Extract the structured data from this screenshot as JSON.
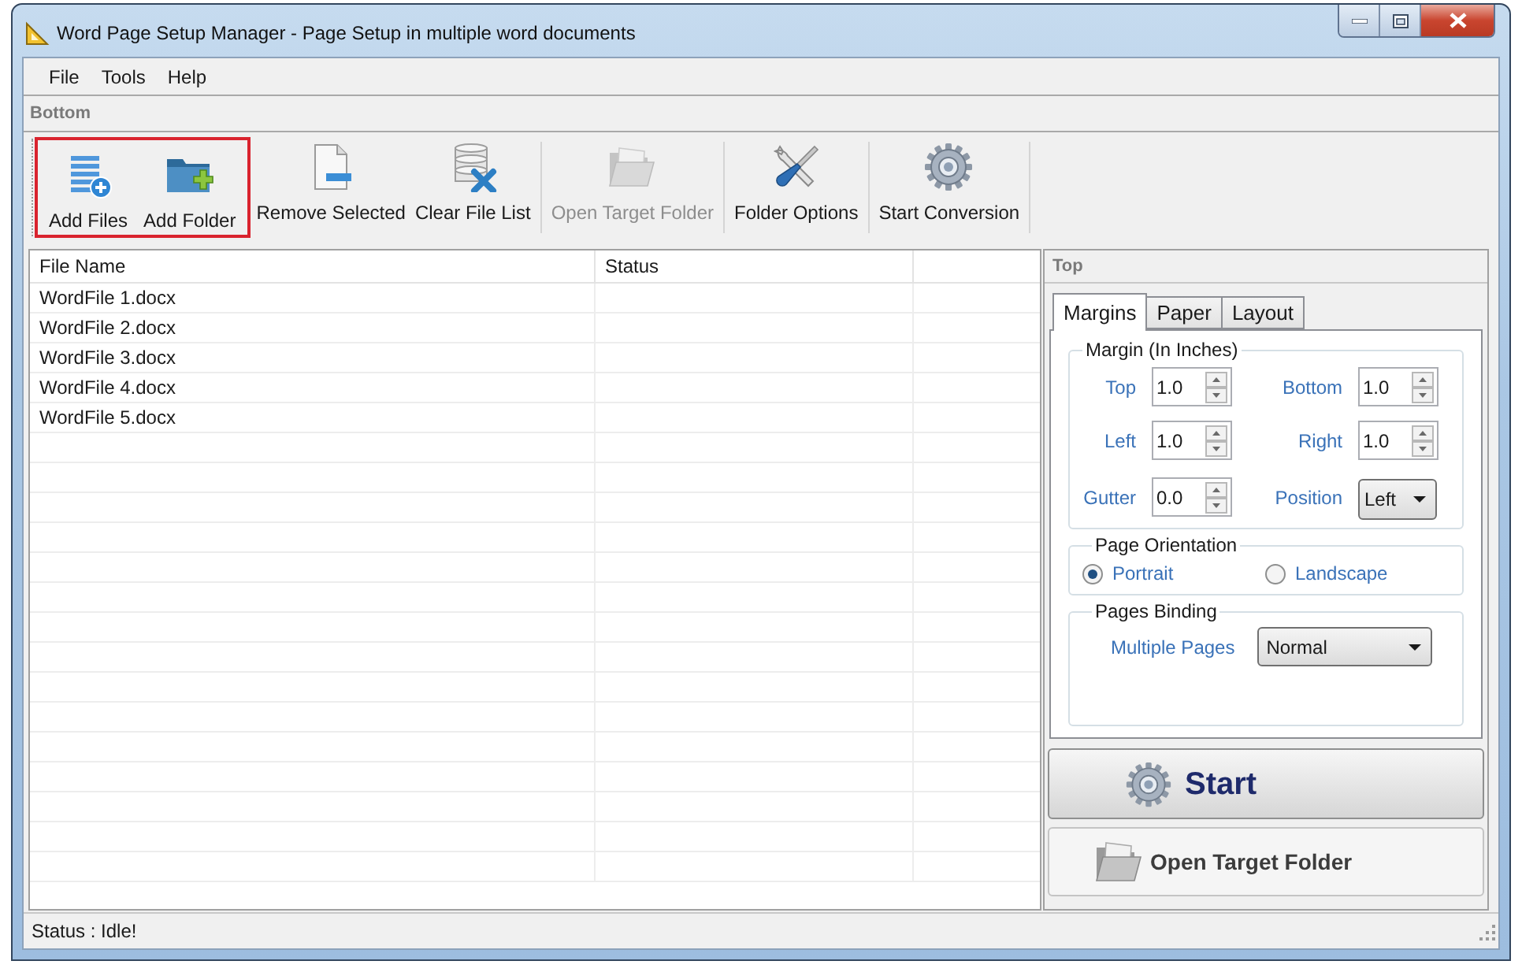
{
  "window": {
    "title": "Word Page Setup Manager - Page Setup in multiple word documents"
  },
  "menu": [
    {
      "label": "File"
    },
    {
      "label": "Tools"
    },
    {
      "label": "Help"
    }
  ],
  "toolbar": {
    "title": "Bottom",
    "groups": [
      [
        {
          "label": "Add Files",
          "disabled": false,
          "highlighted": true
        },
        {
          "label": "Add Folder",
          "disabled": false,
          "highlighted": true
        },
        {
          "label": "Remove Selected",
          "disabled": false,
          "highlighted": false
        },
        {
          "label": "Clear File List",
          "disabled": false,
          "highlighted": false
        }
      ],
      [
        {
          "label": "Open Target Folder",
          "disabled": true,
          "highlighted": false
        }
      ],
      [
        {
          "label": "Folder Options",
          "disabled": false,
          "highlighted": false
        }
      ],
      [
        {
          "label": "Start Conversion",
          "disabled": false,
          "highlighted": false
        }
      ]
    ]
  },
  "file_list": {
    "columns": [
      "File Name",
      "Status"
    ],
    "rows": [
      {
        "file_name": "WordFile 1.docx"
      },
      {
        "file_name": "WordFile 2.docx"
      },
      {
        "file_name": "WordFile 3.docx"
      },
      {
        "file_name": "WordFile 4.docx"
      },
      {
        "file_name": "WordFile 5.docx"
      }
    ]
  },
  "settings_panel": {
    "title": "Top",
    "tabs": [
      {
        "label": "Margins",
        "selected": true
      },
      {
        "label": "Paper",
        "selected": false
      },
      {
        "label": "Layout",
        "selected": false
      }
    ],
    "margin_group": {
      "title": "Margin (In Inches)",
      "fields": [
        {
          "label": "Top",
          "value": "1.0",
          "kind": "spin"
        },
        {
          "label": "Bottom",
          "value": "1.0",
          "kind": "spin"
        },
        {
          "label": "Left",
          "value": "1.0",
          "kind": "spin"
        },
        {
          "label": "Right",
          "value": "1.0",
          "kind": "spin"
        },
        {
          "label": "Gutter",
          "value": "0.0",
          "kind": "spin"
        },
        {
          "label": "Position",
          "value": "Left",
          "kind": "dropdown"
        }
      ]
    },
    "orientation_group": {
      "title": "Page Orientation",
      "options": [
        {
          "label": "Portrait",
          "selected": true
        },
        {
          "label": "Landscape",
          "selected": false
        }
      ]
    },
    "binding_group": {
      "title": "Pages Binding",
      "label": "Multiple Pages",
      "value": "Normal"
    }
  },
  "actions": [
    {
      "label": "Start",
      "kind": "primary"
    },
    {
      "label": "Open Target Folder",
      "kind": "secondary"
    }
  ],
  "status_bar": {
    "text": "Status : Idle!"
  }
}
